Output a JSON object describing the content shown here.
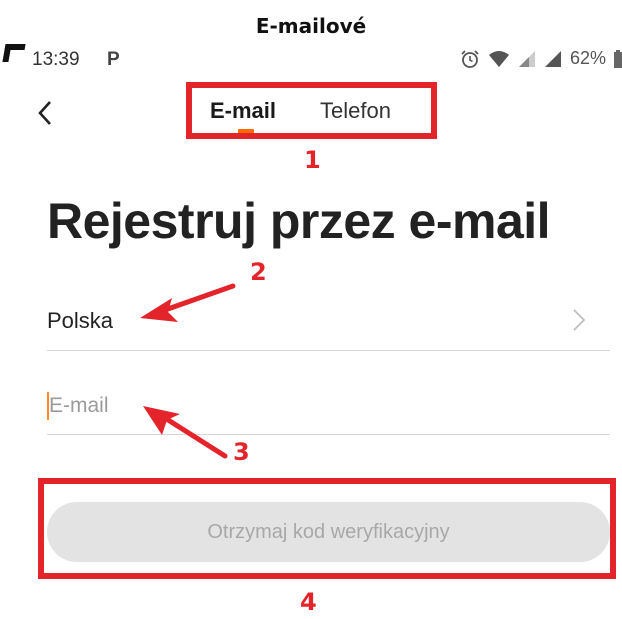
{
  "caption": "E-mailové",
  "status_bar": {
    "time": "13:39",
    "notification_icon": "P",
    "battery": "62%"
  },
  "tabs": [
    {
      "label": "E-mail",
      "active": true
    },
    {
      "label": "Telefon",
      "active": false
    }
  ],
  "page_title": "Rejestruj przez e-mail",
  "country": {
    "label": "Polska"
  },
  "email_field": {
    "value": "",
    "placeholder": "E-mail"
  },
  "submit_button": {
    "label": "Otrzymaj kod weryfikacyjny"
  },
  "annotations": [
    "1",
    "2",
    "3",
    "4"
  ],
  "colors": {
    "annotation": "#e3242b",
    "tab_indicator": "#ff6a00",
    "button_bg": "#e3e3e3",
    "button_text": "#a8a8a8"
  }
}
